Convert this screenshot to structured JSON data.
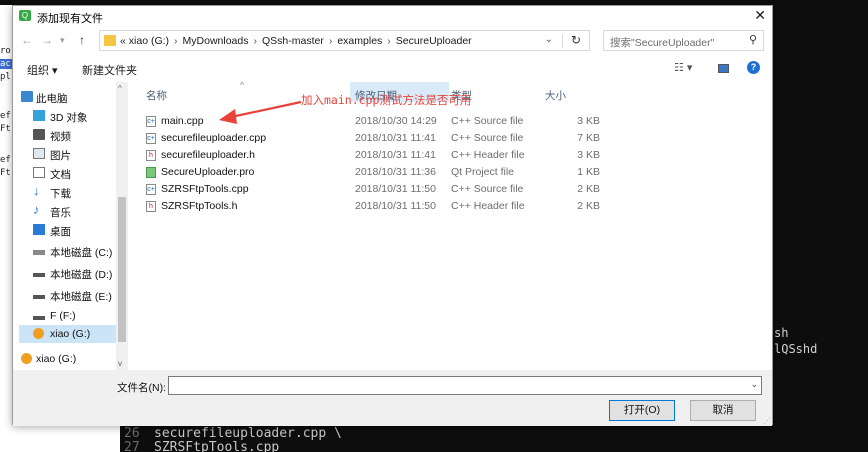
{
  "window": {
    "title": "添加现有文件",
    "close_glyph": "✕"
  },
  "nav": {
    "back_glyph": "←",
    "forward_glyph": "→",
    "dropdown_glyph": "▾",
    "up_glyph": "↑",
    "breadcrumb": [
      "«",
      "xiao (G:)",
      "MyDownloads",
      "QSsh-master",
      "examples",
      "SecureUploader"
    ],
    "breadcrumb_sep": "›",
    "addr_dropdown_glyph": "⌄",
    "refresh_glyph": "↻",
    "search_placeholder": "搜索\"SecureUploader\"",
    "search_glyph": "⚲"
  },
  "toolbar": {
    "organize": "组织 ▾",
    "new_folder": "新建文件夹",
    "view_menu": "☷ ▾",
    "help_glyph": "?"
  },
  "sidebar": {
    "items": [
      {
        "label": "此电脑",
        "icon": "computer-icon"
      },
      {
        "label": "3D 对象",
        "icon": "3d-objects-icon"
      },
      {
        "label": "视频",
        "icon": "video-icon"
      },
      {
        "label": "图片",
        "icon": "pictures-icon"
      },
      {
        "label": "文档",
        "icon": "documents-icon"
      },
      {
        "label": "下载",
        "icon": "downloads-icon"
      },
      {
        "label": "音乐",
        "icon": "music-icon"
      },
      {
        "label": "桌面",
        "icon": "desktop-icon"
      },
      {
        "label": "本地磁盘 (C:)",
        "icon": "drive-c-icon"
      },
      {
        "label": "本地磁盘 (D:)",
        "icon": "drive-d-icon"
      },
      {
        "label": "本地磁盘 (E:)",
        "icon": "drive-e-icon"
      },
      {
        "label": "F (F:)",
        "icon": "drive-f-icon"
      },
      {
        "label": "xiao (G:)",
        "icon": "drive-g-icon",
        "selected": true
      },
      {
        "label": "xiao (G:)",
        "icon": "drive-g-icon"
      }
    ],
    "scroll_up_glyph": "^",
    "scroll_down_glyph": "v"
  },
  "columns": {
    "name": "名称",
    "date": "修改日期",
    "type": "类型",
    "size": "大小",
    "sort_glyph": "^"
  },
  "files": [
    {
      "name": "main.cpp",
      "date": "2018/10/30 14:29",
      "type": "C++ Source file",
      "size": "3 KB",
      "kind": "cpp"
    },
    {
      "name": "securefileuploader.cpp",
      "date": "2018/10/31 11:41",
      "type": "C++ Source file",
      "size": "7 KB",
      "kind": "cpp"
    },
    {
      "name": "securefileuploader.h",
      "date": "2018/10/31 11:41",
      "type": "C++ Header file",
      "size": "3 KB",
      "kind": "h"
    },
    {
      "name": "SecureUploader.pro",
      "date": "2018/10/31 11:36",
      "type": "Qt Project file",
      "size": "1 KB",
      "kind": "pro"
    },
    {
      "name": "SZRSFtpTools.cpp",
      "date": "2018/10/31 11:50",
      "type": "C++ Source file",
      "size": "2 KB",
      "kind": "cpp"
    },
    {
      "name": "SZRSFtpTools.h",
      "date": "2018/10/31 11:50",
      "type": "C++ Header file",
      "size": "2 KB",
      "kind": "h"
    }
  ],
  "annotation": {
    "text": "加入main.cpp测试方法是否可用",
    "color": "#e8423a"
  },
  "bottom": {
    "filename_label": "文件名(N):",
    "filename_value": "",
    "filename_dropdown_glyph": "⌄",
    "open_label": "打开(O)",
    "cancel_label": "取消"
  },
  "terminal": {
    "left_fragments": [
      "ro",
      "ac",
      "pl",
      "ef",
      "Ft",
      "ef",
      "Ft"
    ],
    "right_fragments": [
      "sh",
      "lQSshd"
    ],
    "lines": [
      {
        "num": "26",
        "text": "securefileuploader.cpp \\"
      },
      {
        "num": "27",
        "text": "SZRSFtpTools.cpp"
      }
    ]
  },
  "colors": {
    "accent": "#0078d7",
    "selection": "#cce4f7",
    "terminal_bg": "#0d0d0d"
  }
}
